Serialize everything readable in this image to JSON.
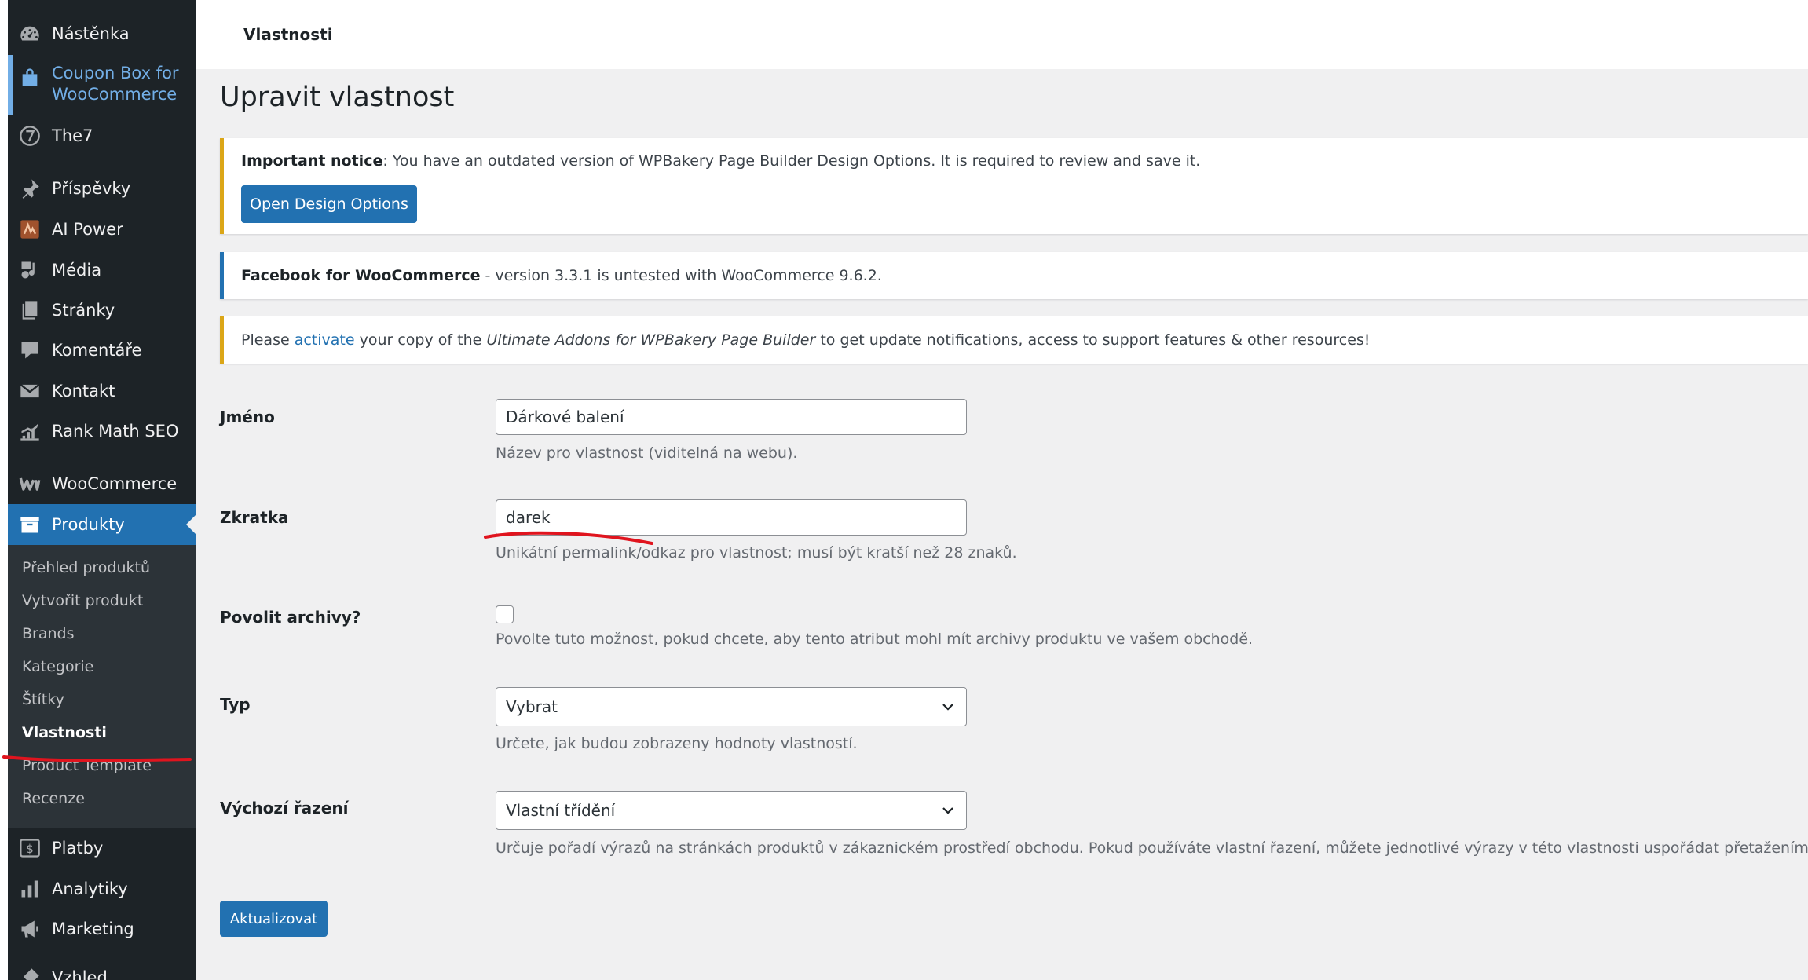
{
  "sidebar": {
    "items": [
      {
        "label": "Nástěnka",
        "icon": "dashboard-icon"
      },
      {
        "label": "Coupon Box for WooCommerce",
        "icon": "coupon-box-icon"
      },
      {
        "label": "The7",
        "icon": "the7-icon"
      },
      {
        "label": "Příspěvky",
        "icon": "pin-icon"
      },
      {
        "label": "AI Power",
        "icon": "ai-power-icon"
      },
      {
        "label": "Média",
        "icon": "media-icon"
      },
      {
        "label": "Stránky",
        "icon": "pages-icon"
      },
      {
        "label": "Komentáře",
        "icon": "comments-icon"
      },
      {
        "label": "Kontakt",
        "icon": "mail-icon"
      },
      {
        "label": "Rank Math SEO",
        "icon": "rank-math-icon"
      },
      {
        "label": "WooCommerce",
        "icon": "woocommerce-icon"
      },
      {
        "label": "Produkty",
        "icon": "products-icon"
      },
      {
        "label": "Platby",
        "icon": "payments-icon"
      },
      {
        "label": "Analytiky",
        "icon": "analytics-icon"
      },
      {
        "label": "Marketing",
        "icon": "megaphone-icon"
      },
      {
        "label": "Vzhled",
        "icon": "appearance-icon"
      }
    ],
    "coupon_line1": "Coupon Box for",
    "coupon_line2": "WooCommerce",
    "submenu": [
      "Přehled produktů",
      "Vytvořit produkt",
      "Brands",
      "Kategorie",
      "Štítky",
      "Vlastnosti",
      "Product Template",
      "Recenze"
    ]
  },
  "header": {
    "title": "Vlastnosti"
  },
  "main": {
    "page_title": "Upravit vlastnost",
    "notices": {
      "wpbakery": {
        "bold": "Important notice",
        "text": ": You have an outdated version of WPBakery Page Builder Design Options. It is required to review and save it.",
        "button": "Open Design Options"
      },
      "facebook": {
        "bold": "Facebook for WooCommerce",
        "text": " - version 3.3.1 is untested with WooCommerce 9.6.2."
      },
      "ultimate": {
        "prefix": "Please ",
        "link": "activate",
        "middle": " your copy of the ",
        "italic": "Ultimate Addons for WPBakery Page Builder",
        "suffix": " to get update notifications, access to support features & other resources!"
      }
    },
    "form": {
      "name_label": "Jméno",
      "name_value": "Dárkové balení",
      "name_desc": "Název pro vlastnost (viditelná na webu).",
      "slug_label": "Zkratka",
      "slug_value": "darek",
      "slug_desc": "Unikátní permalink/odkaz pro vlastnost; musí být kratší než 28 znaků.",
      "archive_label": "Povolit archivy?",
      "archive_checked": false,
      "archive_desc": "Povolte tuto možnost, pokud chcete, aby tento atribut mohl mít archivy produktu ve vašem obchodě.",
      "type_label": "Typ",
      "type_value": "Vybrat",
      "type_desc": "Určete, jak budou zobrazeny hodnoty vlastností.",
      "order_label": "Výchozí řazení",
      "order_value": "Vlastní třídění",
      "order_desc": "Určuje pořadí výrazů na stránkách produktů v zákaznickém prostředí obchodu. Pokud používáte vlastní řazení, můžete jednotlivé výrazy v této vlastnosti uspořádat přetažením.",
      "submit": "Aktualizovat"
    }
  },
  "colors": {
    "sidebar_bg": "#1d2327",
    "accent": "#2271b1",
    "warning": "#dba617",
    "annotation": "#e0141e"
  }
}
